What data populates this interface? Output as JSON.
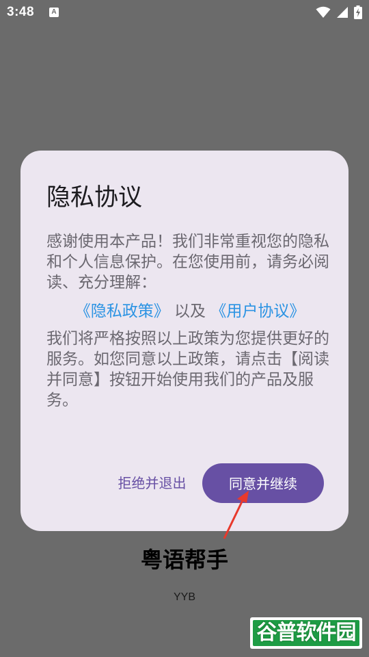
{
  "status_bar": {
    "time": "3:48",
    "notification_icon": "a-icon",
    "icons": [
      "wifi-icon",
      "signal-icon",
      "battery-charging-icon"
    ]
  },
  "app": {
    "title": "粤语帮手",
    "subtitle": "YYB"
  },
  "dialog": {
    "title": "隐私协议",
    "paragraph1": "感谢使用本产品！我们非常重视您的隐私和个人信息保护。在您使用前，请务必阅读、充分理解：",
    "privacy_link": "《隐私政策》",
    "and_text": "以及",
    "user_agreement_link": "《用户协议》",
    "paragraph2": "我们将严格按照以上政策为您提供更好的服务。如您同意以上政策，请点击【阅读并同意】按钮开始使用我们的产品及服务。",
    "refuse_label": "拒绝并退出",
    "agree_label": "同意并继续"
  },
  "watermark": {
    "text": "谷普软件园"
  },
  "colors": {
    "scrim": "#6b6b6b",
    "dialog_bg": "#ece6f0",
    "primary": "#6750a4",
    "link": "#2b93e3",
    "arrow": "#e8392c"
  }
}
